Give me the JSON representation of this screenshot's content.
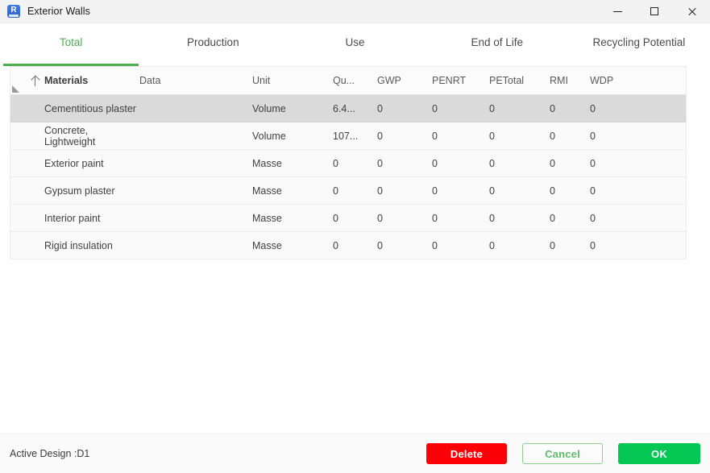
{
  "window": {
    "title": "Exterior Walls",
    "icon": "revit-app-icon",
    "controls": [
      {
        "name": "minimize",
        "glyph": "—"
      },
      {
        "name": "maximize",
        "glyph": "□"
      },
      {
        "name": "close",
        "glyph": "✕"
      }
    ]
  },
  "tabs": [
    {
      "label": "Total",
      "active": true
    },
    {
      "label": "Production",
      "active": false
    },
    {
      "label": "Use",
      "active": false
    },
    {
      "label": "End of Life",
      "active": false
    },
    {
      "label": "Recycling Potential",
      "active": false
    }
  ],
  "table": {
    "sort_column": "Materials",
    "sort_direction": "ascending",
    "columns": [
      "Materials",
      "Data",
      "Unit",
      "Qu...",
      "GWP",
      "PENRT",
      "PETotal",
      "RMI",
      "WDP"
    ],
    "rows": [
      {
        "material": "Cementitious plaster",
        "data": "",
        "unit": "Volume",
        "qu": "6.4...",
        "gwp": "0",
        "penrt": "0",
        "petotal": "0",
        "rmi": "0",
        "wdp": "0",
        "selected": true
      },
      {
        "material": "Concrete, Lightweight",
        "data": "",
        "unit": "Volume",
        "qu": "107...",
        "gwp": "0",
        "penrt": "0",
        "petotal": "0",
        "rmi": "0",
        "wdp": "0",
        "selected": false
      },
      {
        "material": "Exterior paint",
        "data": "",
        "unit": "Masse",
        "qu": "0",
        "gwp": "0",
        "penrt": "0",
        "petotal": "0",
        "rmi": "0",
        "wdp": "0",
        "selected": false
      },
      {
        "material": "Gypsum plaster",
        "data": "",
        "unit": "Masse",
        "qu": "0",
        "gwp": "0",
        "penrt": "0",
        "petotal": "0",
        "rmi": "0",
        "wdp": "0",
        "selected": false
      },
      {
        "material": "Interior paint",
        "data": "",
        "unit": "Masse",
        "qu": "0",
        "gwp": "0",
        "penrt": "0",
        "petotal": "0",
        "rmi": "0",
        "wdp": "0",
        "selected": false
      },
      {
        "material": "Rigid insulation",
        "data": "",
        "unit": "Masse",
        "qu": "0",
        "gwp": "0",
        "penrt": "0",
        "petotal": "0",
        "rmi": "0",
        "wdp": "0",
        "selected": false
      }
    ]
  },
  "footer": {
    "status": "Active Design :D1",
    "buttons": {
      "delete": "Delete",
      "cancel": "Cancel",
      "ok": "OK"
    }
  },
  "colors": {
    "accent_green": "#4caf50",
    "ok_green": "#04c853",
    "cancel_green": "#5cbf67",
    "delete_red": "#fb0007",
    "selected_row": "#dadada"
  }
}
